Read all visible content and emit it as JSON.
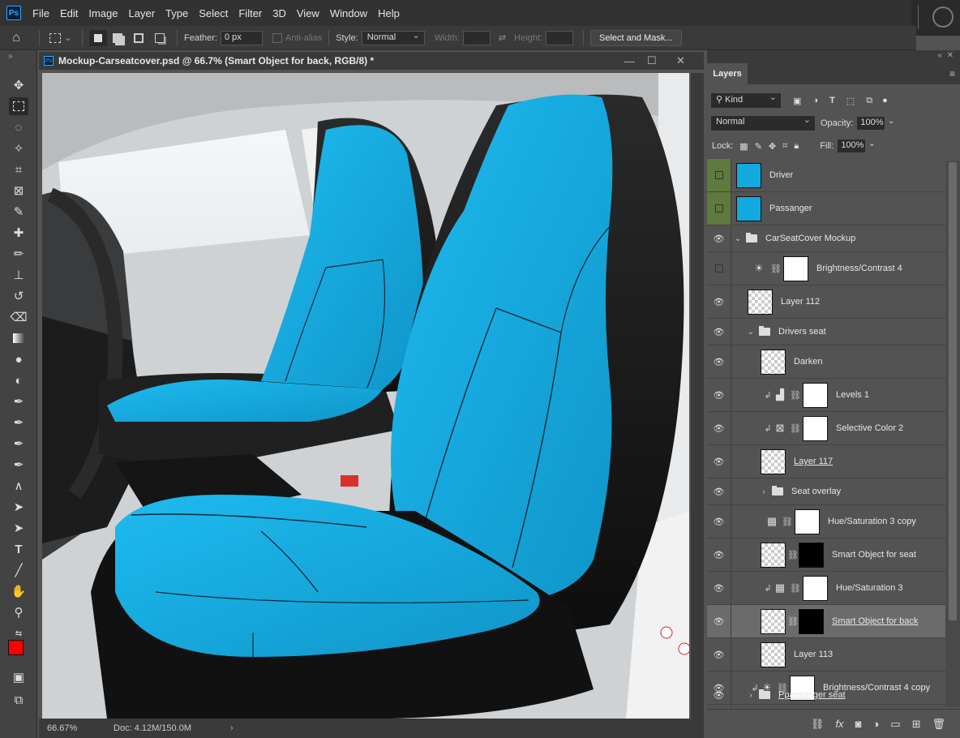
{
  "app": {
    "logo": "Ps",
    "menus": [
      "File",
      "Edit",
      "Image",
      "Layer",
      "Type",
      "Select",
      "Filter",
      "3D",
      "View",
      "Window",
      "Help"
    ]
  },
  "options": {
    "feather_label": "Feather:",
    "feather_value": "0 px",
    "antialias_label": "Anti-alias",
    "style_label": "Style:",
    "style_value": "Normal",
    "width_label": "Width:",
    "height_label": "Height:",
    "select_mask_label": "Select and Mask..."
  },
  "document": {
    "tab_title": "Mockup-Carseatcover.psd @ 66.7% (Smart Object for back, RGB/8) *",
    "zoom": "66.67%",
    "doc_info": "Doc: 4.12M/150.0M",
    "seat_color": "#12a9de"
  },
  "layers_panel": {
    "tab": "Layers",
    "filter_kind": "Kind",
    "blend_mode": "Normal",
    "opacity_label": "Opacity:",
    "opacity_value": "100%",
    "lock_label": "Lock:",
    "fill_label": "Fill:",
    "fill_value": "100%",
    "layers": [
      {
        "name": "Driver"
      },
      {
        "name": "Passanger"
      },
      {
        "name": "CarSeatCover Mockup"
      },
      {
        "name": "Brightness/Contrast 4"
      },
      {
        "name": "Layer 112"
      },
      {
        "name": "Drivers seat"
      },
      {
        "name": "Darken"
      },
      {
        "name": "Levels 1"
      },
      {
        "name": "Selective Color 2"
      },
      {
        "name": "Layer 117"
      },
      {
        "name": "Seat overlay"
      },
      {
        "name": "Hue/Saturation 3 copy"
      },
      {
        "name": "Smart Object for seat"
      },
      {
        "name": "Hue/Saturation 3"
      },
      {
        "name": "Smart Object for back"
      },
      {
        "name": "Layer 113"
      },
      {
        "name": "Brightness/Contrast 4 copy"
      },
      {
        "name": "Ppassanger seat"
      }
    ]
  },
  "colors": {
    "foreground": "#ff0000",
    "background": "#ffffff"
  }
}
